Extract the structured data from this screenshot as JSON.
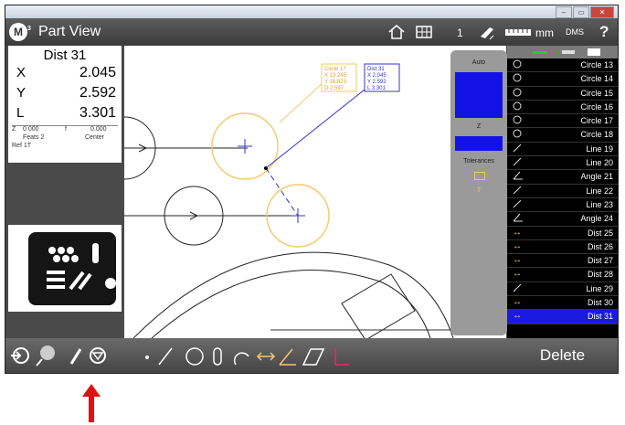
{
  "window": {
    "minimize": "–",
    "maximize": "▭",
    "close": "✕"
  },
  "toolbar": {
    "logo": "M",
    "logo_sup": "3",
    "title": "Part View",
    "home_icon": "home-icon",
    "grid_icon": "grid-icon",
    "count": "1",
    "units": "mm",
    "angle_mode": "DMS",
    "help": "?"
  },
  "dro": {
    "title": "Dist 31",
    "rows": [
      {
        "label": "X",
        "value": "2.045"
      },
      {
        "label": "Y",
        "value": "2.592"
      },
      {
        "label": "L",
        "value": "3.301"
      }
    ],
    "z_label": "Z",
    "z_value": "0.000",
    "f_label": "f",
    "f_value": "0.000",
    "feats_label": "Feats 2",
    "center_label": "Center",
    "ref_label": "Ref 1T"
  },
  "right_pane": {
    "auto_label": "Auto",
    "z_label": "Z",
    "tolerances_label": "Tolerances",
    "tol_t": "T"
  },
  "callouts": {
    "circle": {
      "title": "Circle 17",
      "x": "X  13.245",
      "y": "Y  16.823",
      "d": "D   2.597"
    },
    "dist": {
      "title": "Dist 31",
      "x": "X  2.045",
      "y": "Y  2.592",
      "l": "L  3.301"
    }
  },
  "features": [
    {
      "icon": "circle-icon",
      "label": "Circle 13",
      "selected": false
    },
    {
      "icon": "circle-icon",
      "label": "Circle 14",
      "selected": false
    },
    {
      "icon": "circle-icon",
      "label": "Circle 15",
      "selected": false
    },
    {
      "icon": "circle-icon",
      "label": "Circle 16",
      "selected": false
    },
    {
      "icon": "circle-icon",
      "label": "Circle 17",
      "selected": false
    },
    {
      "icon": "circle-icon",
      "label": "Circle 18",
      "selected": false
    },
    {
      "icon": "line-icon",
      "label": "Line 19",
      "selected": false
    },
    {
      "icon": "line-icon",
      "label": "Line 20",
      "selected": false
    },
    {
      "icon": "angle-icon",
      "label": "Angle 21",
      "selected": false
    },
    {
      "icon": "line-icon",
      "label": "Line 22",
      "selected": false
    },
    {
      "icon": "line-icon",
      "label": "Line 23",
      "selected": false
    },
    {
      "icon": "angle-icon",
      "label": "Angle 24",
      "selected": false
    },
    {
      "icon": "distance-icon",
      "label": "Dist 25",
      "selected": false
    },
    {
      "icon": "distance-icon",
      "label": "Dist 26",
      "selected": false
    },
    {
      "icon": "distance-icon",
      "label": "Dist 27",
      "selected": false
    },
    {
      "icon": "distance-icon",
      "label": "Dist 28",
      "selected": false
    },
    {
      "icon": "line-icon",
      "label": "Line 29",
      "selected": false
    },
    {
      "icon": "distance-icon",
      "label": "Dist 30",
      "selected": false
    },
    {
      "icon": "distance-icon",
      "label": "Dist 31",
      "selected": true
    }
  ],
  "bottom": {
    "delete_label": "Delete"
  },
  "colors": {
    "accent_blue": "#1b1bdd",
    "feature_orange": "#f4c86a",
    "dimension_blue": "#3333cc",
    "arrow_red": "#e01010"
  }
}
